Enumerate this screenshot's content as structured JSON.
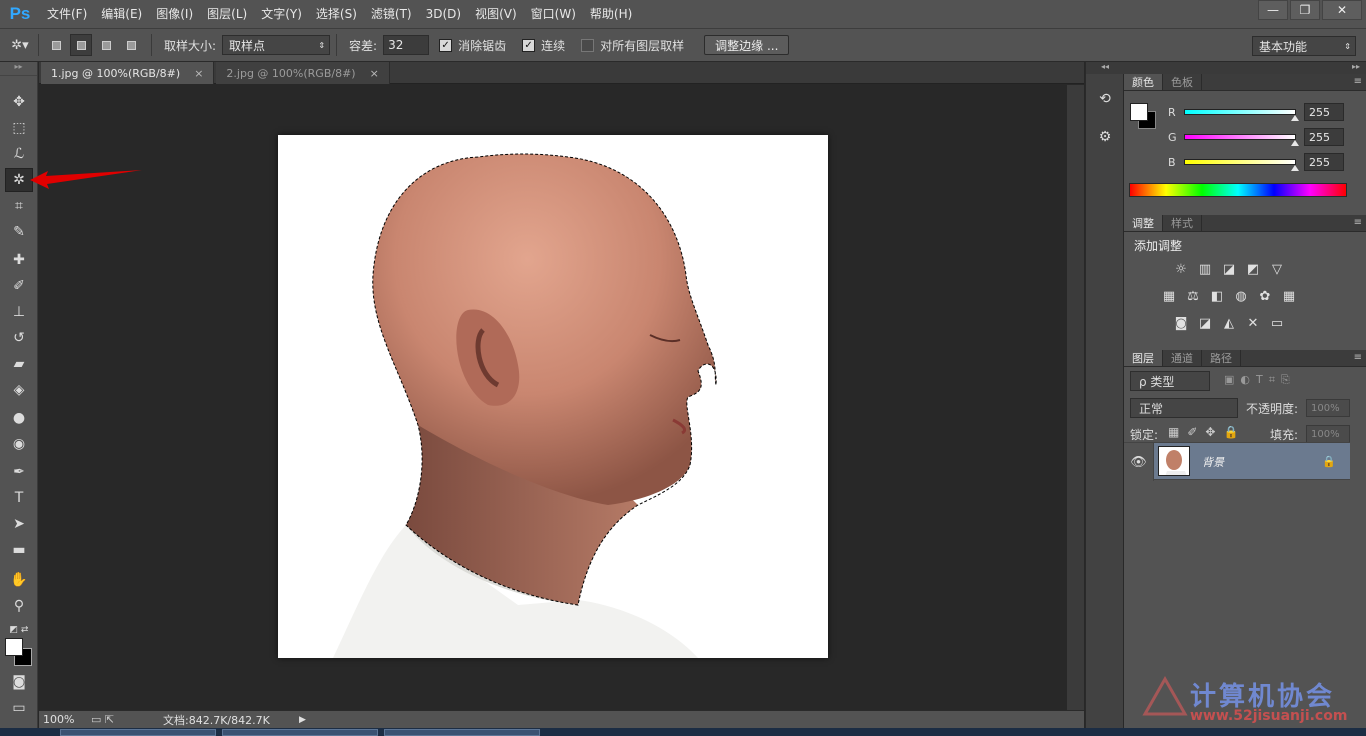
{
  "app": {
    "logo": "Ps"
  },
  "menu": [
    "文件(F)",
    "编辑(E)",
    "图像(I)",
    "图层(L)",
    "文字(Y)",
    "选择(S)",
    "滤镜(T)",
    "3D(D)",
    "视图(V)",
    "窗口(W)",
    "帮助(H)"
  ],
  "window_controls": {
    "minimize": "—",
    "restore": "❐",
    "close": "✕"
  },
  "options": {
    "sample_size_label": "取样大小:",
    "sample_size_value": "取样点",
    "tolerance_label": "容差:",
    "tolerance_value": "32",
    "antialias_label": "消除锯齿",
    "antialias_checked": true,
    "contiguous_label": "连续",
    "contiguous_checked": true,
    "all_layers_label": "对所有图层取样",
    "all_layers_checked": false,
    "refine_edge_button": "调整边缘 ...",
    "workspace_value": "基本功能"
  },
  "tabs": [
    {
      "label": "1.jpg @ 100%(RGB/8#)",
      "close": "×",
      "active": true
    },
    {
      "label": "2.jpg @ 100%(RGB/8#)",
      "close": "×",
      "active": false
    }
  ],
  "status": {
    "zoom": "100%",
    "doc_info": "文档:842.7K/842.7K"
  },
  "color_panel": {
    "tabs": [
      "颜色",
      "色板"
    ],
    "channels": [
      {
        "label": "R",
        "value": "255",
        "color": "#00ffff"
      },
      {
        "label": "G",
        "value": "255",
        "color": "#ff00ff"
      },
      {
        "label": "B",
        "value": "255",
        "color": "#ffff00"
      }
    ]
  },
  "adjust_panel": {
    "tabs": [
      "调整",
      "样式"
    ],
    "title": "添加调整",
    "icons": [
      "brightness-icon",
      "levels-icon",
      "curves-icon",
      "exposure-icon",
      "vibrance-icon",
      "hue-icon",
      "balance-icon",
      "bw-icon",
      "photo-filter-icon",
      "channel-mixer-icon",
      "color-lookup-icon",
      "invert-icon",
      "posterize-icon",
      "threshold-icon",
      "gradient-map-icon"
    ]
  },
  "layers_panel": {
    "tabs": [
      "图层",
      "通道",
      "路径"
    ],
    "kind_filter": "ρ 类型",
    "blend_mode": "正常",
    "opacity_label": "不透明度:",
    "opacity_value": "100%",
    "lock_label": "锁定:",
    "fill_label": "填充:",
    "fill_value": "100%",
    "layer_name": "背景"
  },
  "watermark": {
    "text": "计算机协会",
    "url": "www.52jisuanji.com"
  }
}
